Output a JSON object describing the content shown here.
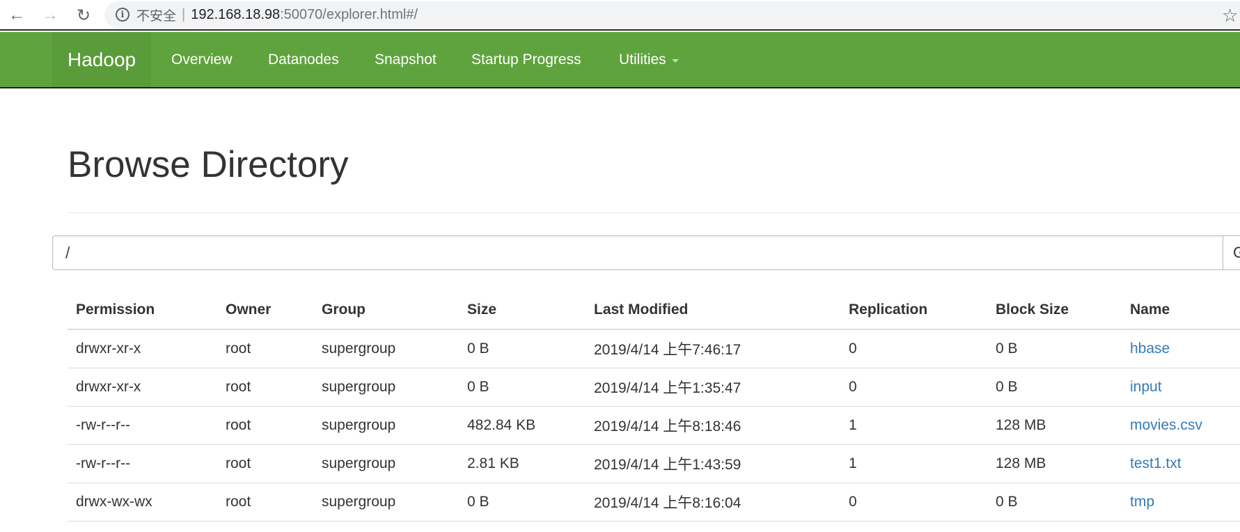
{
  "browser": {
    "back_icon": "←",
    "forward_icon": "→",
    "reload_icon": "↻",
    "info_icon": "i",
    "insecure_label": "不安全",
    "separator": "|",
    "url_host": "192.168.18.98",
    "url_rest": ":50070/explorer.html#/",
    "star_icon": "☆"
  },
  "navbar": {
    "brand": "Hadoop",
    "items": [
      {
        "label": "Overview"
      },
      {
        "label": "Datanodes"
      },
      {
        "label": "Snapshot"
      },
      {
        "label": "Startup Progress"
      },
      {
        "label": "Utilities"
      }
    ]
  },
  "page": {
    "title": "Browse Directory"
  },
  "path": {
    "value": "/",
    "go_label": "G"
  },
  "table": {
    "headers": [
      "Permission",
      "Owner",
      "Group",
      "Size",
      "Last Modified",
      "Replication",
      "Block Size",
      "Name"
    ],
    "rows": [
      {
        "permission": "drwxr-xr-x",
        "owner": "root",
        "group": "supergroup",
        "size": "0 B",
        "modified": "2019/4/14 上午7:46:17",
        "replication": "0",
        "block_size": "0 B",
        "name": "hbase"
      },
      {
        "permission": "drwxr-xr-x",
        "owner": "root",
        "group": "supergroup",
        "size": "0 B",
        "modified": "2019/4/14 上午1:35:47",
        "replication": "0",
        "block_size": "0 B",
        "name": "input"
      },
      {
        "permission": "-rw-r--r--",
        "owner": "root",
        "group": "supergroup",
        "size": "482.84 KB",
        "modified": "2019/4/14 上午8:18:46",
        "replication": "1",
        "block_size": "128 MB",
        "name": "movies.csv"
      },
      {
        "permission": "-rw-r--r--",
        "owner": "root",
        "group": "supergroup",
        "size": "2.81 KB",
        "modified": "2019/4/14 上午1:43:59",
        "replication": "1",
        "block_size": "128 MB",
        "name": "test1.txt"
      },
      {
        "permission": "drwx-wx-wx",
        "owner": "root",
        "group": "supergroup",
        "size": "0 B",
        "modified": "2019/4/14 上午8:16:04",
        "replication": "0",
        "block_size": "0 B",
        "name": "tmp"
      }
    ]
  },
  "colors": {
    "navbar_bg": "#5fa33e",
    "link": "#337ab7",
    "text": "#333333"
  }
}
